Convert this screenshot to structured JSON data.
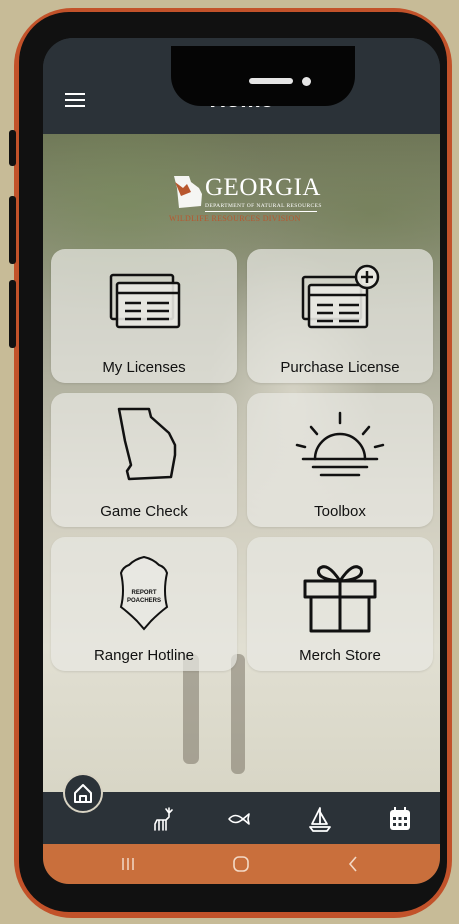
{
  "header": {
    "title": "Home"
  },
  "logo": {
    "name": "GEORGIA",
    "department": "DEPARTMENT OF NATURAL RESOURCES",
    "division": "WILDLIFE RESOURCES DIVISION"
  },
  "tiles": [
    {
      "label": "My Licenses",
      "icon": "license-card-icon"
    },
    {
      "label": "Purchase License",
      "icon": "license-add-icon"
    },
    {
      "label": "Game Check",
      "icon": "georgia-map-icon"
    },
    {
      "label": "Toolbox",
      "icon": "sunrise-icon"
    },
    {
      "label": "Ranger Hotline",
      "icon": "report-poachers-badge-icon",
      "badge_text": "REPORT POACHERS"
    },
    {
      "label": "Merch Store",
      "icon": "gift-icon"
    }
  ],
  "bottom_nav": [
    "home-icon",
    "deer-icon",
    "fish-icon",
    "sailboat-icon",
    "calendar-icon"
  ],
  "system_nav": [
    "recent-apps-icon",
    "home-circle-icon",
    "back-icon"
  ],
  "colors": {
    "appbar": "#2b3238",
    "frame": "#c2522a",
    "system_nav": "#c96f3c"
  }
}
